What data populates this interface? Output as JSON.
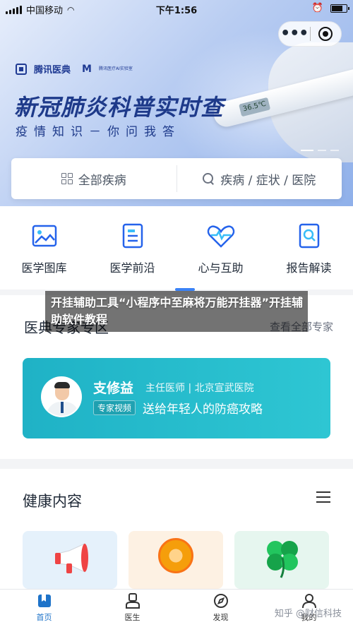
{
  "status_bar": {
    "carrier": "中国移动",
    "time": "下午1:56"
  },
  "hero": {
    "brand_name": "腾讯医典",
    "brand_small": "腾讯医疗AI实验室",
    "title": "新冠肺炎科普实时查",
    "subtitle": "疫情知识－你问我答",
    "thermometer_reading": "36.5℃"
  },
  "search": {
    "left_label": "全部疾病",
    "right_placeholder": "疾病 / 症状 / 医院"
  },
  "quick_nav": [
    {
      "label": "医学图库"
    },
    {
      "label": "医学前沿"
    },
    {
      "label": "心与互助"
    },
    {
      "label": "报告解读"
    }
  ],
  "overlay_caption": "开挂辅助工具“小程序中至麻将万能开挂器”开挂辅助软件教程",
  "expert": {
    "section_title": "医典专家专区",
    "more_label": "查看全部专家",
    "doctor_name": "支修益",
    "doctor_meta": "主任医师 | 北京宣武医院",
    "tag": "专家视频",
    "topic": "送给年轻人的防癌攻略"
  },
  "health": {
    "section_title": "健康内容"
  },
  "tabbar": [
    {
      "label": "首页",
      "active": true
    },
    {
      "label": "医生",
      "active": false
    },
    {
      "label": "发现",
      "active": false
    },
    {
      "label": "我的",
      "active": false
    }
  ],
  "watermark": "知乎 @财信科技",
  "colors": {
    "accent": "#1e73c9",
    "teal": "#1fb2c6",
    "hero_blue": "#1e3a8a"
  }
}
